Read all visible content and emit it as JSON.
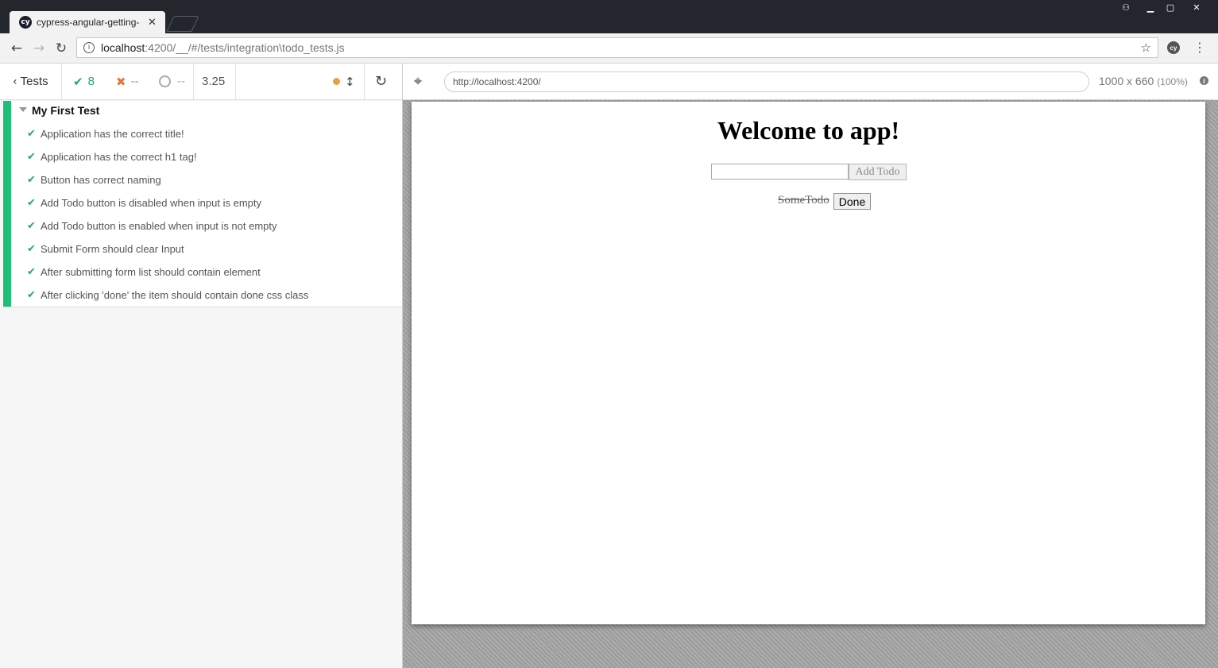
{
  "window": {
    "tab_title": "cypress-angular-getting-",
    "tab_favicon": "cy",
    "controls": {
      "profile": "⚇",
      "minimize": "▁",
      "maximize": "▢",
      "close": "✕"
    }
  },
  "browser": {
    "url_host": "localhost",
    "url_rest": ":4200/__/#/tests/integration\\todo_tests.js",
    "extension_badge": "cy",
    "icons": {
      "back": "arrow-left-icon",
      "forward": "arrow-right-icon",
      "reload": "reload-icon",
      "star": "star-icon",
      "menu": "kebab-menu-icon"
    }
  },
  "reporter": {
    "tests_label": "Tests",
    "passed": "8",
    "failed": "--",
    "pending": "--",
    "duration": "3.25",
    "suite": {
      "title": "My First Test",
      "tests": [
        "Application has the correct title!",
        "Application has the correct h1 tag!",
        "Button has correct naming",
        "Add Todo button is disabled when input is empty",
        "Add Todo button is enabled when input is not empty",
        "Submit Form should clear Input",
        "After submitting form list should contain element",
        "After clicking 'done' the item should contain done css class"
      ]
    },
    "colors": {
      "pass": "#22a675",
      "fail": "#e07b39",
      "running": "#e8a23d",
      "suite_bar": "#1fbf78"
    }
  },
  "aut": {
    "url": "http://localhost:4200/",
    "viewport": "1000 x 660",
    "viewport_pct": "(100%)",
    "app": {
      "heading": "Welcome to app!",
      "input_value": "",
      "add_button": "Add Todo",
      "todo_item": "SomeTodo",
      "done_button": "Done"
    }
  }
}
